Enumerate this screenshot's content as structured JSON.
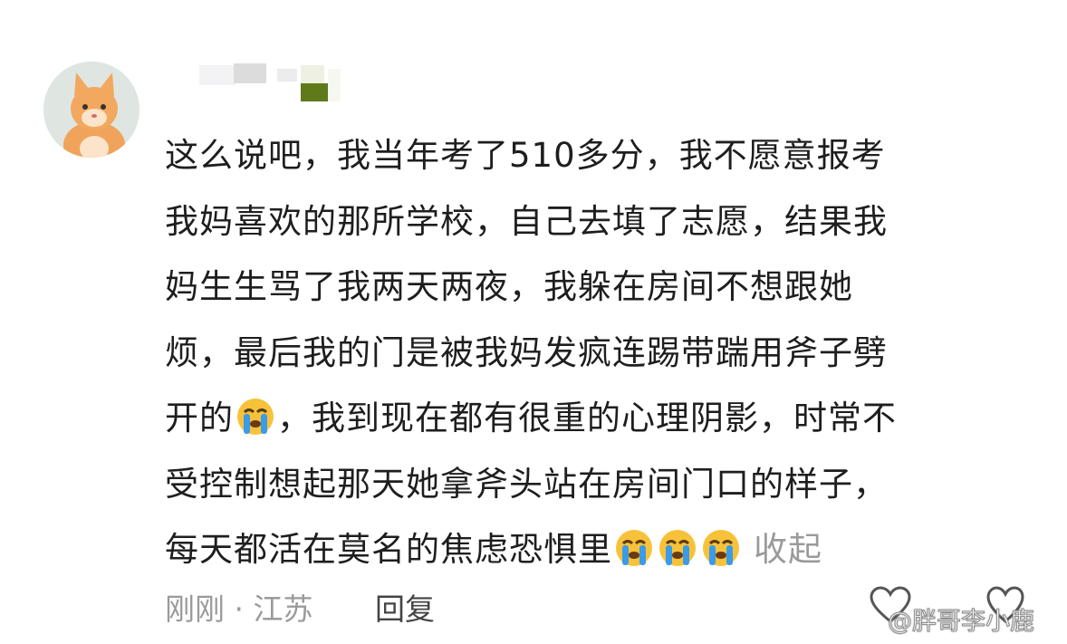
{
  "comment": {
    "lines": [
      "这么说吧，我当年考了510多分，我不愿意报考",
      "我妈喜欢的那所学校，自己去填了志愿，结果我",
      "妈生生骂了我两天两夜，我躲在房间不想跟她",
      "烦，最后我的门是被我妈发疯连踢带踹用斧子劈"
    ],
    "line5_before_emoji": "开的",
    "line5_after_emoji": "，我到现在都有很重的心理阴影，时常不",
    "line6": "受控制想起那天她拿斧头站在房间门口的样子，",
    "line7": "每天都活在莫名的焦虑恐惧里",
    "collapse_label": "收起"
  },
  "meta": {
    "time": "刚刚",
    "separator": "·",
    "location": "江苏",
    "reply_label": "回复"
  },
  "watermark": "@胖哥李小鹿",
  "icons": {
    "avatar": "cat-avatar",
    "emoji": "crying-face-emoji",
    "like": "heart-outline-icon"
  },
  "colors": {
    "text": "#1e1e1e",
    "muted": "#9b9b9b",
    "emoji_face": "#f7c23a",
    "emoji_tear": "#3a9be8"
  }
}
